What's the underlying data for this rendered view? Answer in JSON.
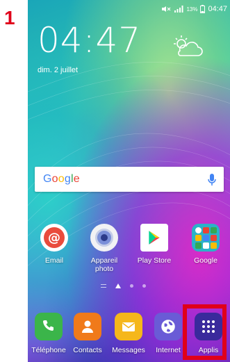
{
  "step_number": "1",
  "status_bar": {
    "battery_percent": "13%",
    "time": "04:47",
    "icons": [
      "mute-icon",
      "signal-icon",
      "battery-icon"
    ]
  },
  "lock_clock": {
    "time": "04:47",
    "date": "dim. 2 juillet",
    "weather_icon": "partly-cloudy-icon"
  },
  "search_widget": {
    "logo": "Google",
    "mic_icon": "mic-icon"
  },
  "home_apps": [
    {
      "label": "Email",
      "icon": "email-icon"
    },
    {
      "label": "Appareil photo",
      "icon": "camera-icon"
    },
    {
      "label": "Play Store",
      "icon": "play-store-icon"
    },
    {
      "label": "Google",
      "icon": "google-folder-icon"
    }
  ],
  "page_indicator": {
    "pages": 4,
    "current": 1
  },
  "dock": [
    {
      "label": "Téléphone",
      "icon": "phone-icon"
    },
    {
      "label": "Contacts",
      "icon": "contacts-icon"
    },
    {
      "label": "Messages",
      "icon": "messages-icon"
    },
    {
      "label": "Internet",
      "icon": "internet-icon"
    },
    {
      "label": "Applis",
      "icon": "apps-grid-icon"
    }
  ],
  "colors": {
    "highlight": "#e0001a",
    "google_blue": "#4285f4",
    "google_red": "#ea4335",
    "google_yellow": "#fbbc05",
    "google_green": "#34a853"
  }
}
